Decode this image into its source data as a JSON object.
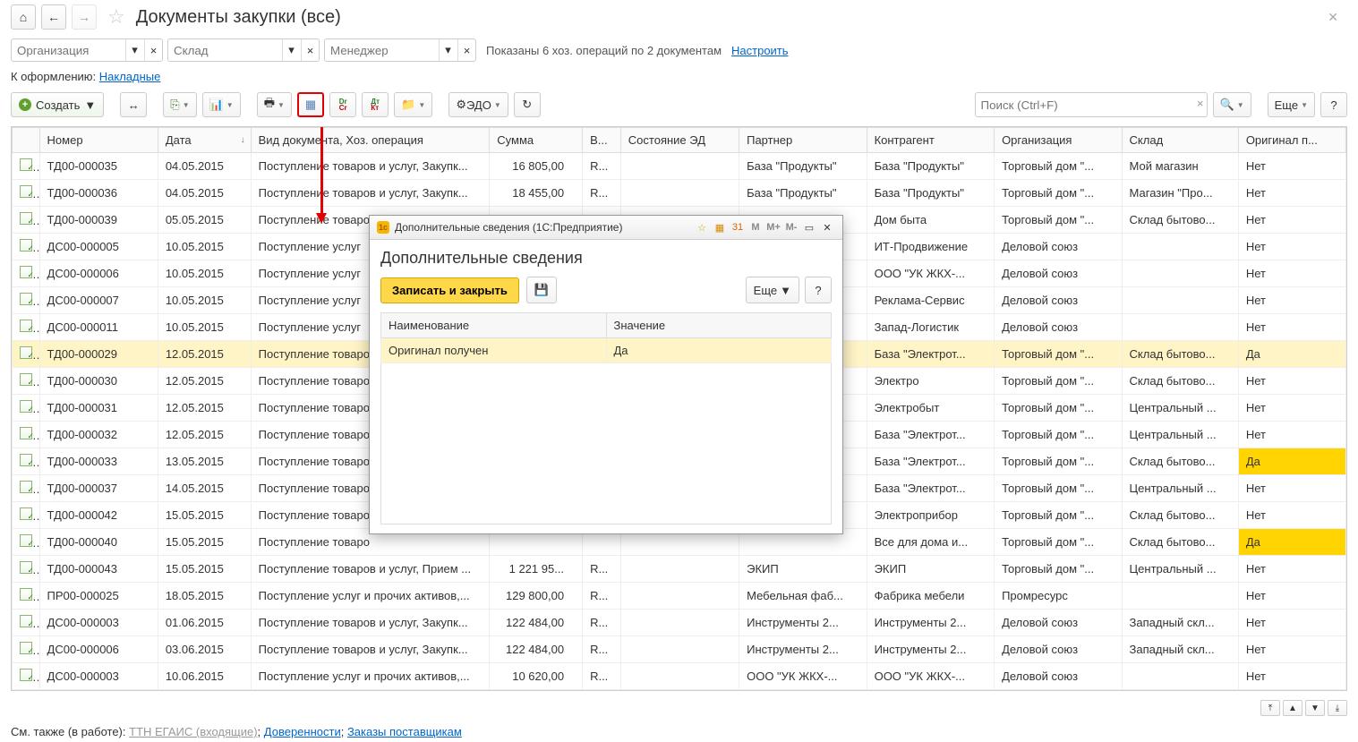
{
  "pageTitle": "Документы закупки (все)",
  "filters": {
    "org": {
      "placeholder": "Организация"
    },
    "store": {
      "placeholder": "Склад"
    },
    "manager": {
      "placeholder": "Менеджер"
    }
  },
  "summary": "Показаны 6 хоз. операций по 2 документам",
  "configureLink": "Настроить",
  "toProcessLabel": "К оформлению:",
  "toProcessLink": "Накладные",
  "createLabel": "Создать",
  "edoLabel": "ЭДО",
  "moreLabel": "Еще",
  "searchPlaceholder": "Поиск (Ctrl+F)",
  "columns": [
    "Номер",
    "Дата",
    "Вид документа, Хоз. операция",
    "Сумма",
    "В...",
    "Состояние ЭД",
    "Партнер",
    "Контрагент",
    "Организация",
    "Склад",
    "Оригинал п..."
  ],
  "rows": [
    {
      "num": "ТД00-000035",
      "date": "04.05.2015",
      "type": "Поступление товаров и услуг, Закупк...",
      "sum": "16 805,00",
      "v": "R...",
      "partner": "База \"Продукты\"",
      "ctr": "База \"Продукты\"",
      "org": "Торговый дом \"...",
      "store": "Мой магазин",
      "orig": "Нет"
    },
    {
      "num": "ТД00-000036",
      "date": "04.05.2015",
      "type": "Поступление товаров и услуг, Закупк...",
      "sum": "18 455,00",
      "v": "R...",
      "partner": "База \"Продукты\"",
      "ctr": "База \"Продукты\"",
      "org": "Торговый дом \"...",
      "store": "Магазин \"Про...",
      "orig": "Нет"
    },
    {
      "num": "ТД00-000039",
      "date": "05.05.2015",
      "type": "Поступление товаро",
      "sum": "",
      "v": "",
      "partner": "",
      "ctr": "Дом быта",
      "org": "Торговый дом \"...",
      "store": "Склад бытово...",
      "orig": "Нет"
    },
    {
      "num": "ДС00-000005",
      "date": "10.05.2015",
      "type": "Поступление услуг",
      "sum": "",
      "v": "",
      "partner": "",
      "ctr": "ИТ-Продвижение",
      "org": "Деловой союз",
      "store": "",
      "orig": "Нет"
    },
    {
      "num": "ДС00-000006",
      "date": "10.05.2015",
      "type": "Поступление услуг",
      "sum": "",
      "v": "",
      "partner": "",
      "ctr": "ООО \"УК ЖКХ-...",
      "org": "Деловой союз",
      "store": "",
      "orig": "Нет"
    },
    {
      "num": "ДС00-000007",
      "date": "10.05.2015",
      "type": "Поступление услуг",
      "sum": "",
      "v": "",
      "partner": "",
      "ctr": "Реклама-Сервис",
      "org": "Деловой союз",
      "store": "",
      "orig": "Нет"
    },
    {
      "num": "ДС00-000011",
      "date": "10.05.2015",
      "type": "Поступление услуг",
      "sum": "",
      "v": "",
      "partner": "",
      "ctr": "Запад-Логистик",
      "org": "Деловой союз",
      "store": "",
      "orig": "Нет"
    },
    {
      "num": "ТД00-000029",
      "date": "12.05.2015",
      "type": "Поступление товаро",
      "sum": "",
      "v": "",
      "partner": "",
      "ctr": "База \"Электрот...",
      "org": "Торговый дом \"...",
      "store": "Склад бытово...",
      "orig": "Да",
      "hl": true,
      "oy": true
    },
    {
      "num": "ТД00-000030",
      "date": "12.05.2015",
      "type": "Поступление товаро",
      "sum": "",
      "v": "",
      "partner": "",
      "ctr": "Электро",
      "org": "Торговый дом \"...",
      "store": "Склад бытово...",
      "orig": "Нет"
    },
    {
      "num": "ТД00-000031",
      "date": "12.05.2015",
      "type": "Поступление товаро",
      "sum": "",
      "v": "",
      "partner": "",
      "ctr": "Электробыт",
      "org": "Торговый дом \"...",
      "store": "Центральный ...",
      "orig": "Нет"
    },
    {
      "num": "ТД00-000032",
      "date": "12.05.2015",
      "type": "Поступление товаро",
      "sum": "",
      "v": "",
      "partner": "",
      "ctr": "База \"Электрот...",
      "org": "Торговый дом \"...",
      "store": "Центральный ...",
      "orig": "Нет"
    },
    {
      "num": "ТД00-000033",
      "date": "13.05.2015",
      "type": "Поступление товаро",
      "sum": "",
      "v": "",
      "partner": "",
      "ctr": "База \"Электрот...",
      "org": "Торговый дом \"...",
      "store": "Склад бытово...",
      "orig": "Да",
      "oy": true
    },
    {
      "num": "ТД00-000037",
      "date": "14.05.2015",
      "type": "Поступление товаро",
      "sum": "",
      "v": "",
      "partner": "",
      "ctr": "База \"Электрот...",
      "org": "Торговый дом \"...",
      "store": "Центральный ...",
      "orig": "Нет"
    },
    {
      "num": "ТД00-000042",
      "date": "15.05.2015",
      "type": "Поступление товаро",
      "sum": "",
      "v": "",
      "partner": "",
      "ctr": "Электроприбор",
      "org": "Торговый дом \"...",
      "store": "Склад бытово...",
      "orig": "Нет"
    },
    {
      "num": "ТД00-000040",
      "date": "15.05.2015",
      "type": "Поступление товаро",
      "sum": "",
      "v": "",
      "partner": "",
      "ctr": "Все для дома и...",
      "org": "Торговый дом \"...",
      "store": "Склад бытово...",
      "orig": "Да",
      "oy": true
    },
    {
      "num": "ТД00-000043",
      "date": "15.05.2015",
      "type": "Поступление товаров и услуг, Прием ...",
      "sum": "1 221 95...",
      "v": "R...",
      "partner": "ЭКИП",
      "ctr": "ЭКИП",
      "org": "Торговый дом \"...",
      "store": "Центральный ...",
      "orig": "Нет"
    },
    {
      "num": "ПР00-000025",
      "date": "18.05.2015",
      "type": "Поступление услуг и прочих активов,...",
      "sum": "129 800,00",
      "v": "R...",
      "partner": "Мебельная фаб...",
      "ctr": "Фабрика мебели",
      "org": "Промресурс",
      "store": "",
      "orig": "Нет"
    },
    {
      "num": "ДС00-000003",
      "date": "01.06.2015",
      "type": "Поступление товаров и услуг, Закупк...",
      "sum": "122 484,00",
      "v": "R...",
      "partner": "Инструменты 2...",
      "ctr": "Инструменты 2...",
      "org": "Деловой союз",
      "store": "Западный скл...",
      "orig": "Нет"
    },
    {
      "num": "ДС00-000006",
      "date": "03.06.2015",
      "type": "Поступление товаров и услуг, Закупк...",
      "sum": "122 484,00",
      "v": "R...",
      "partner": "Инструменты 2...",
      "ctr": "Инструменты 2...",
      "org": "Деловой союз",
      "store": "Западный скл...",
      "orig": "Нет"
    },
    {
      "num": "ДС00-000003",
      "date": "10.06.2015",
      "type": "Поступление услуг и прочих активов,...",
      "sum": "10 620,00",
      "v": "R...",
      "partner": "ООО \"УК ЖКХ-...",
      "ctr": "ООО \"УК ЖКХ-...",
      "org": "Деловой союз",
      "store": "",
      "orig": "Нет"
    }
  ],
  "modal": {
    "winTitle": "Дополнительные сведения  (1С:Предприятие)",
    "heading": "Дополнительные сведения",
    "saveClose": "Записать и закрыть",
    "more": "Еще",
    "cols": [
      "Наименование",
      "Значение"
    ],
    "row": {
      "name": "Оригинал получен",
      "val": "Да"
    },
    "memBtns": [
      "M",
      "M+",
      "M-"
    ]
  },
  "footer": {
    "label": "См. также (в работе):",
    "links": [
      "ТТН ЕГАИС (входящие)",
      "Доверенности",
      "Заказы поставщикам"
    ]
  }
}
